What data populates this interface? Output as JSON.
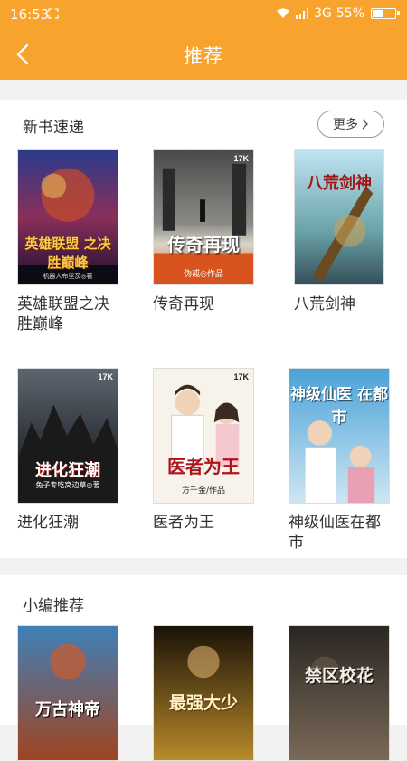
{
  "status_bar": {
    "time": "16:53",
    "network": "3G",
    "battery": "55%",
    "battery_level": 0.55
  },
  "nav": {
    "title": "推荐"
  },
  "new_books": {
    "heading": "新书速递",
    "more_label": "更多",
    "books": [
      {
        "name": "英雄联盟之决胜巅峰",
        "cover_text": "英雄联盟 之决胜巅峰",
        "cover_author": "机器人布里茨◎著"
      },
      {
        "name": "传奇再现",
        "cover_text": "传奇再现",
        "cover_author": "伪戒◎作品"
      },
      {
        "name": "八荒剑神",
        "cover_text": "八荒剑神",
        "cover_author": ""
      },
      {
        "name": "进化狂潮",
        "cover_text": "进化狂潮",
        "cover_author": "兔子专吃窝边草◎著"
      },
      {
        "name": "医者为王",
        "cover_text": "医者为王",
        "cover_author": "方千金/作品"
      },
      {
        "name": "神级仙医在都市",
        "cover_text": "神级仙医 在都市",
        "cover_author": ""
      }
    ]
  },
  "editor_picks": {
    "heading": "小编推荐",
    "books": [
      {
        "cover_text": "万古神帝"
      },
      {
        "cover_text": "最强大少"
      },
      {
        "cover_text": "禁区校花"
      }
    ]
  },
  "colors": {
    "accent": "#f8a32d",
    "background": "#f2f2f2"
  }
}
